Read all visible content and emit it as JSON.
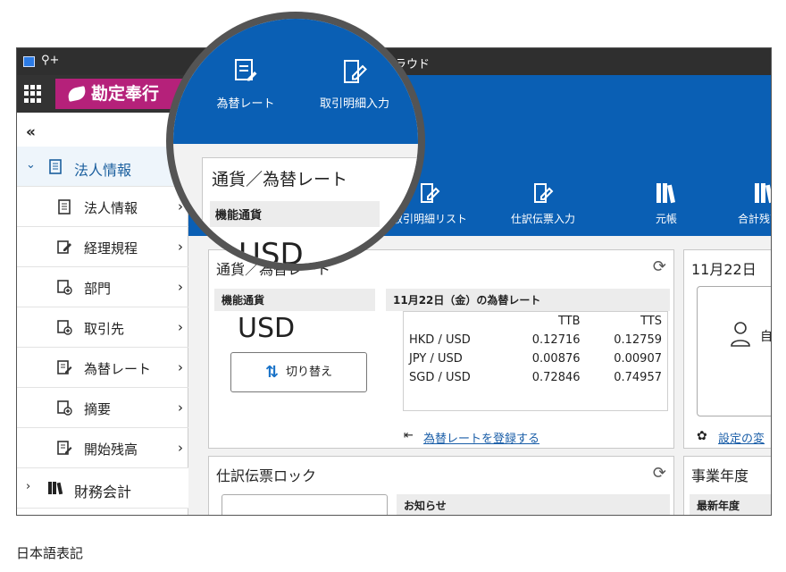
{
  "window": {
    "title": "奉行クラウド"
  },
  "brand": {
    "name": "勘定奉行"
  },
  "sidebar": {
    "collapse": "«",
    "parent": {
      "label": "法人情報"
    },
    "items": [
      {
        "label": "法人情報"
      },
      {
        "label": "経理規程"
      },
      {
        "label": "部門"
      },
      {
        "label": "取引先"
      },
      {
        "label": "為替レート"
      },
      {
        "label": "摘要"
      },
      {
        "label": "開始残高"
      }
    ],
    "next_group": {
      "label": "財務会計"
    }
  },
  "toolbar": {
    "items": [
      {
        "label": "取引明細リスト"
      },
      {
        "label": "仕訳伝票入力"
      },
      {
        "label": "元帳"
      },
      {
        "label": "合計残高試"
      }
    ]
  },
  "magnifier": {
    "buttons": [
      {
        "label": "為替レート"
      },
      {
        "label": "取引明細入力"
      }
    ],
    "panel_title": "通貨／為替レート",
    "functional_currency_label": "機能通貨",
    "functional_currency": "USD"
  },
  "fx_panel": {
    "title": "通貨／為替レート",
    "functional_currency_label": "機能通貨",
    "functional_currency": "USD",
    "switch_button": "切り替え",
    "rate_header": "11月22日（金）の為替レート",
    "columns": [
      "",
      "TTB",
      "TTS"
    ],
    "rows": [
      [
        "HKD / USD",
        "0.12716",
        "0.12759"
      ],
      [
        "JPY / USD",
        "0.00876",
        "0.00907"
      ],
      [
        "SGD / USD",
        "0.72846",
        "0.74957"
      ]
    ],
    "register_link": "為替レートを登録する"
  },
  "date_panel": {
    "title": "11月22日",
    "settings_link": "設定の変",
    "user_partial": "自"
  },
  "lock_panel": {
    "title": "仕訳伝票ロック",
    "notice_label": "お知らせ"
  },
  "fiscal_panel": {
    "title": "事業年度",
    "latest_label": "最新年度"
  },
  "caption": "日本語表記"
}
